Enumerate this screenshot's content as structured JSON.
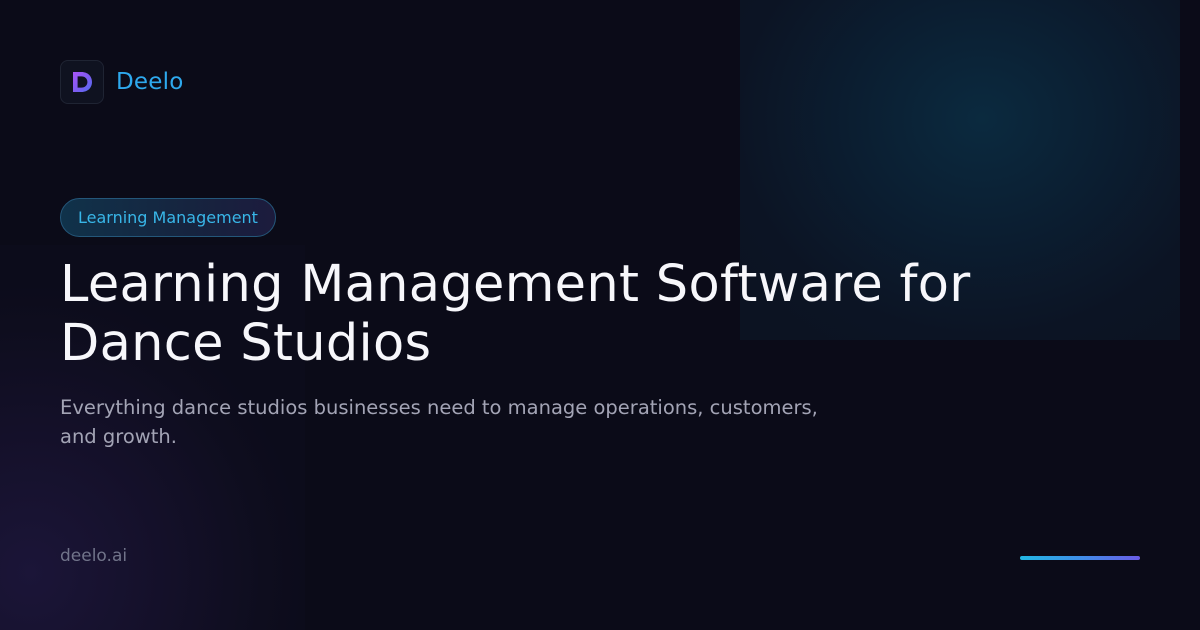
{
  "brand": {
    "logo_icon": "deelo-d-logo-icon",
    "name": "Deelo",
    "accent_color": "#2ea9ee"
  },
  "badge": {
    "label": "Learning Management"
  },
  "headline": {
    "line1": "Learning Management Software for",
    "line2": "Dance Studios"
  },
  "subtitle": {
    "line1": "Everything dance studios businesses need to manage operations, customers,",
    "line2": "and growth."
  },
  "footer": {
    "domain": "deelo.ai"
  },
  "colors": {
    "background": "#0b0b18",
    "title": "#f7f7fb",
    "subtitle": "#a3a4b5",
    "accent_gradient": [
      "#22b7e3",
      "#6a5ce6"
    ]
  }
}
